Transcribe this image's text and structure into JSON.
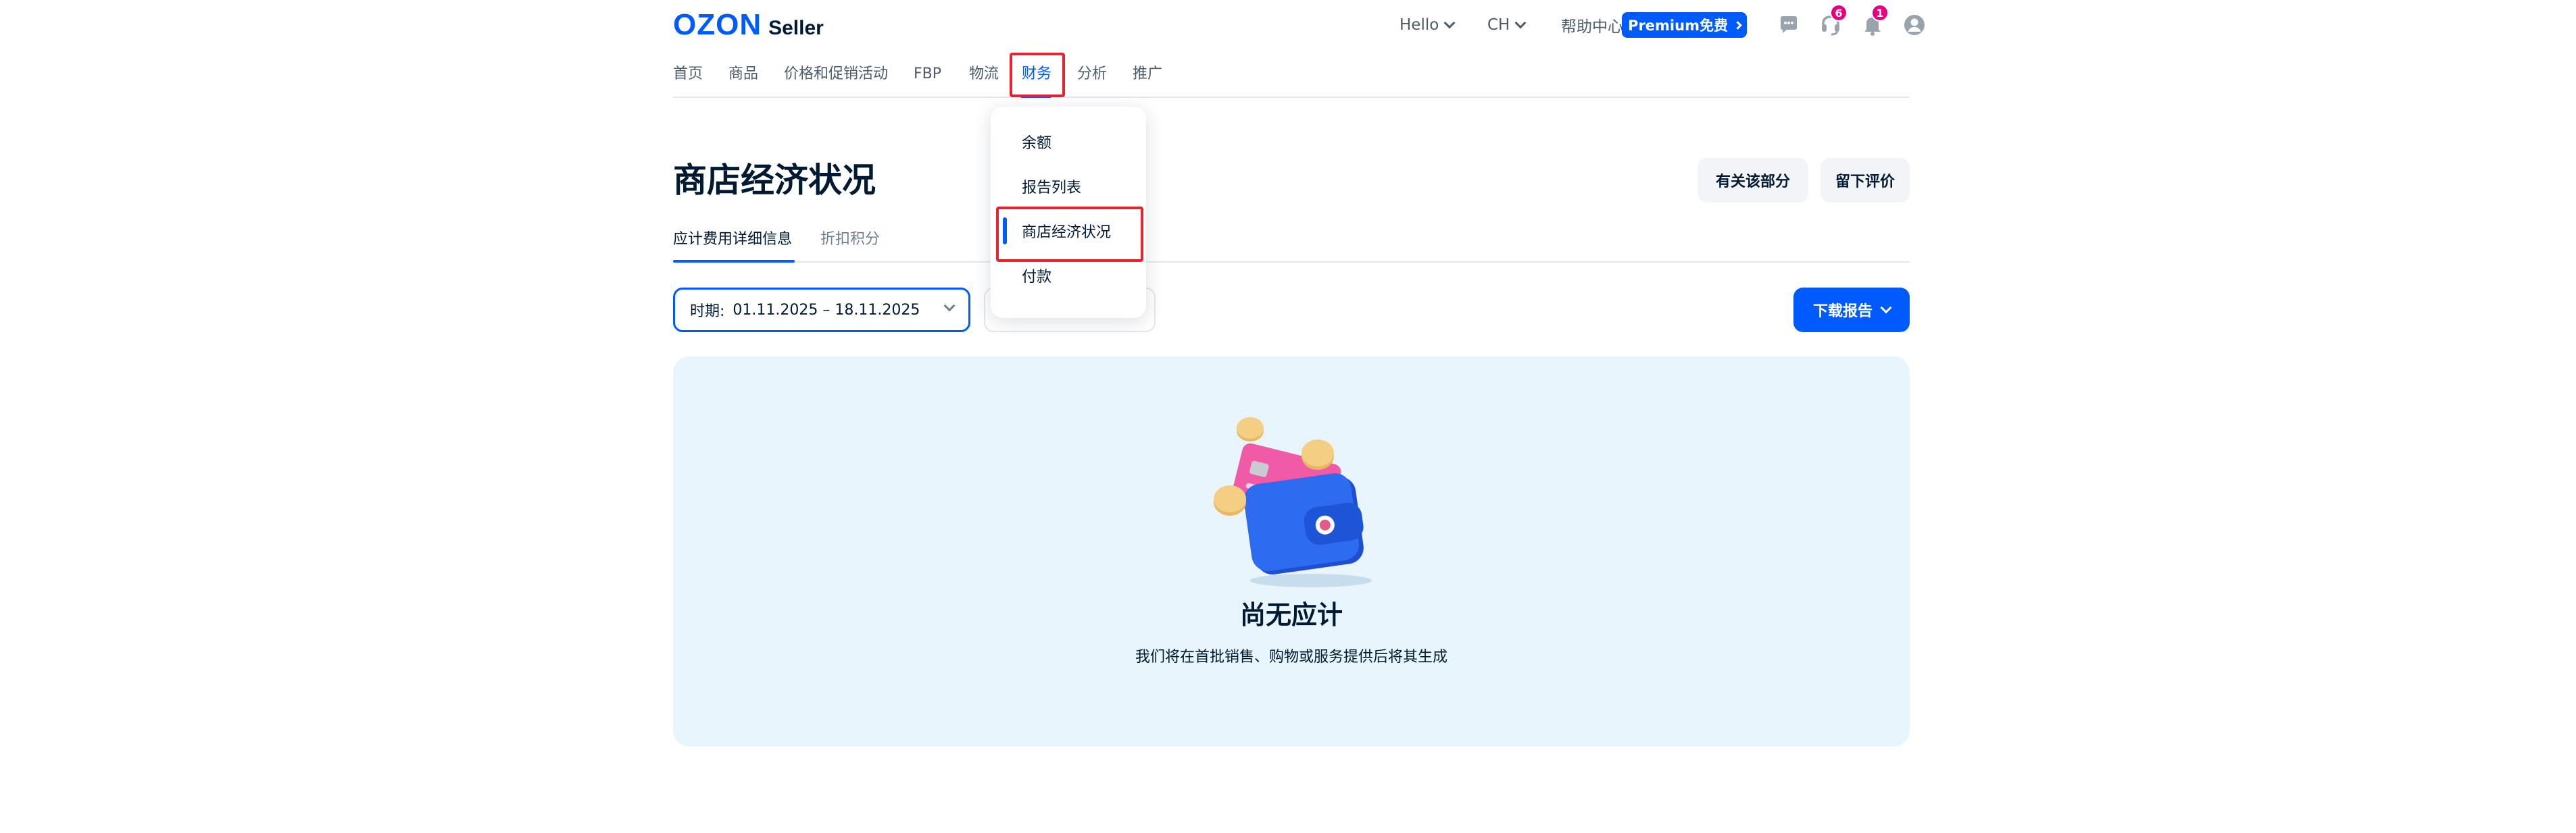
{
  "header": {
    "logo_main": "OZON",
    "logo_sub": "Seller",
    "greeting": "Hello",
    "language": "CH",
    "help": "帮助中心",
    "premium": "Premium免费",
    "badges": {
      "support": "6",
      "notifications": "1"
    }
  },
  "nav": {
    "items": [
      "首页",
      "商品",
      "价格和促销活动",
      "FBP",
      "物流",
      "财务",
      "分析",
      "推广"
    ],
    "active": "财务"
  },
  "dropdown": {
    "items": [
      "余额",
      "报告列表",
      "商店经济状况",
      "付款"
    ],
    "active": "商店经济状况"
  },
  "page": {
    "title": "商店经济状况",
    "about_button": "有关该部分",
    "feedback_button": "留下评价"
  },
  "tabs": [
    "应计费用详细信息",
    "折扣积分"
  ],
  "filters": {
    "period_label": "时期:",
    "period_value": "01.11.2025 – 18.11.2025",
    "download_label": "下载报告"
  },
  "empty_state": {
    "title": "尚无应计",
    "subtitle": "我们将在首批销售、购物或服务提供后将其生成"
  },
  "colors": {
    "accent": "#005bff",
    "badge": "#e6007e",
    "highlight_box": "#e8232e",
    "empty_bg": "#e9f5fd"
  }
}
